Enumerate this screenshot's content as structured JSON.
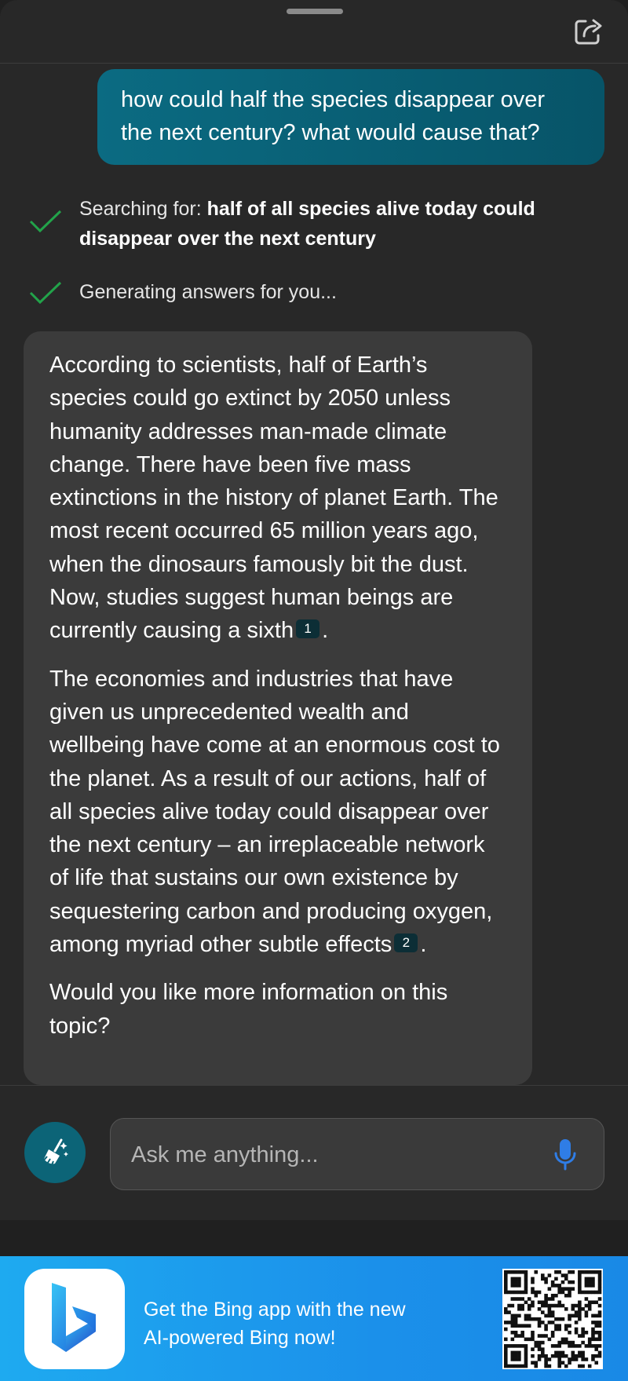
{
  "conversation": {
    "user_message": "how could half the species disappear over the next century? what would cause that?",
    "status": [
      {
        "prefix": "Searching for:",
        "query": "half of all species alive today could disappear over the next century"
      },
      {
        "text": "Generating answers for you..."
      }
    ],
    "response": {
      "p1": "According to scientists, half of Earth’s species could go extinct by 2050 unless humanity addresses man-made climate change. There have been five mass extinctions in the history of planet Earth. The most recent occurred 65 million years ago, when the dinosaurs famously bit the dust. Now, studies suggest human beings are currently causing a sixth",
      "p1_cite": "1",
      "p2": "The economies and industries that have given us unprecedented wealth and wellbeing have come at an enormous cost to the planet. As a result of our actions, half of all species alive today could disappear over the next century – an irreplaceable network of life that sustains our own existence by sequestering carbon and producing oxygen, among myriad other subtle effects",
      "p2_cite": "2",
      "p3": "Would you like more information on this topic?",
      "period": "."
    }
  },
  "composer": {
    "placeholder": "Ask me anything..."
  },
  "banner": {
    "text": "Get the Bing app with the new AI-powered Bing now!"
  },
  "icons": {
    "share": "share-icon",
    "check": "check-icon",
    "broom": "broom-icon",
    "mic": "microphone-icon",
    "logo": "bing-logo",
    "qr": "qr-code"
  },
  "colors": {
    "background": "#282828",
    "user_bubble": "#0b6b82",
    "bot_bubble": "#3b3b3b",
    "check": "#22a34a",
    "mic": "#2f7de6",
    "banner": "#1b90ea"
  }
}
